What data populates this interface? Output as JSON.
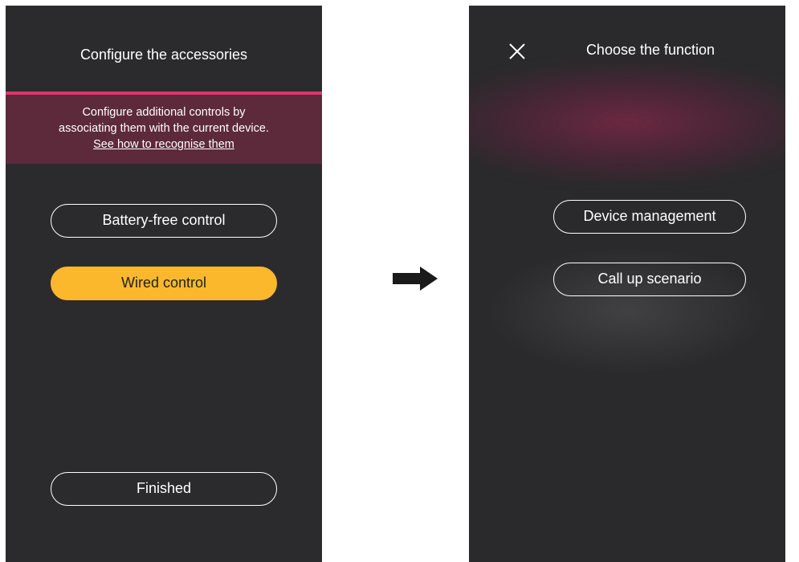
{
  "left_screen": {
    "title": "Configure the accessories",
    "banner": {
      "line1": "Configure additional controls by",
      "line2": "associating them with the current device.",
      "link": "See how to recognise them"
    },
    "buttons": {
      "battery_free": "Battery-free control",
      "wired": "Wired control",
      "finished": "Finished"
    }
  },
  "arrow": {
    "icon": "right-arrow-icon"
  },
  "right_screen": {
    "close_icon": "close-icon",
    "title": "Choose the function",
    "buttons": {
      "device_management": "Device management",
      "call_up_scenario": "Call up scenario"
    }
  },
  "colors": {
    "screen_background": "#2b2b2d",
    "banner_background": "#5c2a3b",
    "banner_accent": "#e0356b",
    "selected_button": "#fbb82c"
  }
}
